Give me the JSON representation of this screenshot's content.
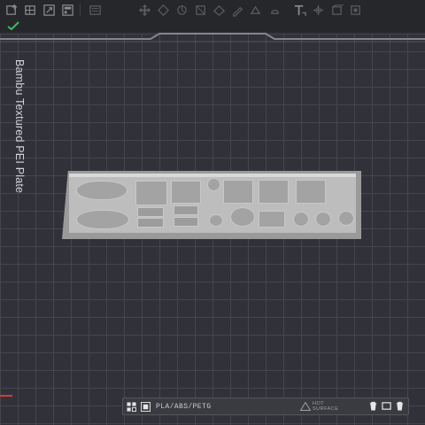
{
  "plate": {
    "label": "Bambu Textured PEI Plate"
  },
  "toolbar": {
    "icons": [
      "add-object-icon",
      "add-plate-icon",
      "orient-icon",
      "arrange-icon",
      "split-icon",
      "move-icon",
      "rotate-icon",
      "scale-icon",
      "lay-on-face-icon",
      "cut-icon",
      "support-paint-icon",
      "seam-paint-icon",
      "color-paint-icon",
      "text-icon",
      "measure-icon",
      "assembly-icon",
      "view-icon"
    ]
  },
  "status_bar": {
    "filament": "PLA/ABS/PETG",
    "surface_line1": "HOT",
    "surface_line2": "SURFACE"
  },
  "colors": {
    "background": "#313239",
    "grid": "#44454d",
    "model": "#bdbdbd",
    "axis_x": "#d63a3a"
  }
}
